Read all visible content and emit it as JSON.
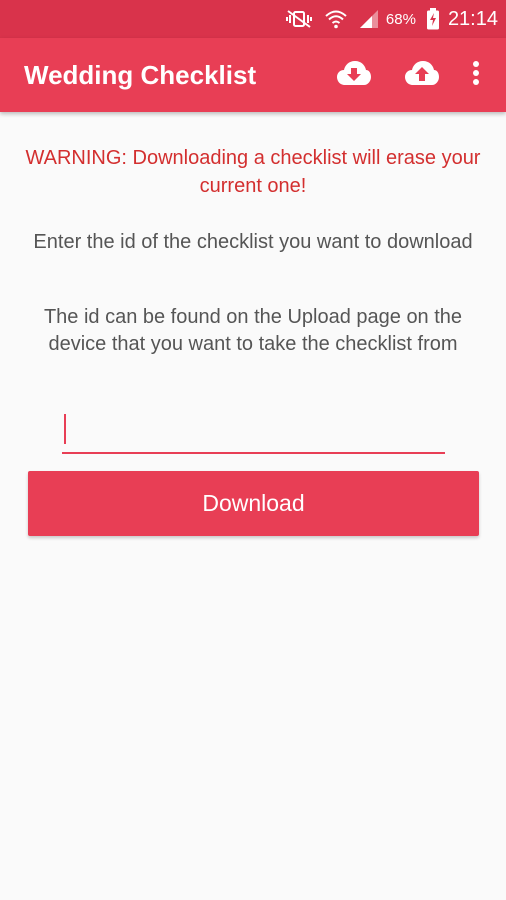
{
  "status_bar": {
    "battery_percent": "68%",
    "time": "21:14",
    "icons": [
      "vibrate-mute-icon",
      "wifi-icon",
      "signal-icon",
      "battery-charging-icon"
    ]
  },
  "app_bar": {
    "title": "Wedding Checklist",
    "actions": [
      "cloud-download-icon",
      "cloud-upload-icon",
      "more-vert-icon"
    ]
  },
  "main": {
    "warning": "WARNING: Downloading a checklist will erase your current one!",
    "instruction_1": "Enter the id of the checklist you want to download",
    "instruction_2": "The id can be found on the Upload page on the device that you want to take the checklist from",
    "id_field": {
      "value": "",
      "placeholder": ""
    },
    "download_label": "Download"
  },
  "colors": {
    "primary": "#e83e55",
    "status_bar": "#d9334b",
    "warning_text": "#d32f2f"
  }
}
